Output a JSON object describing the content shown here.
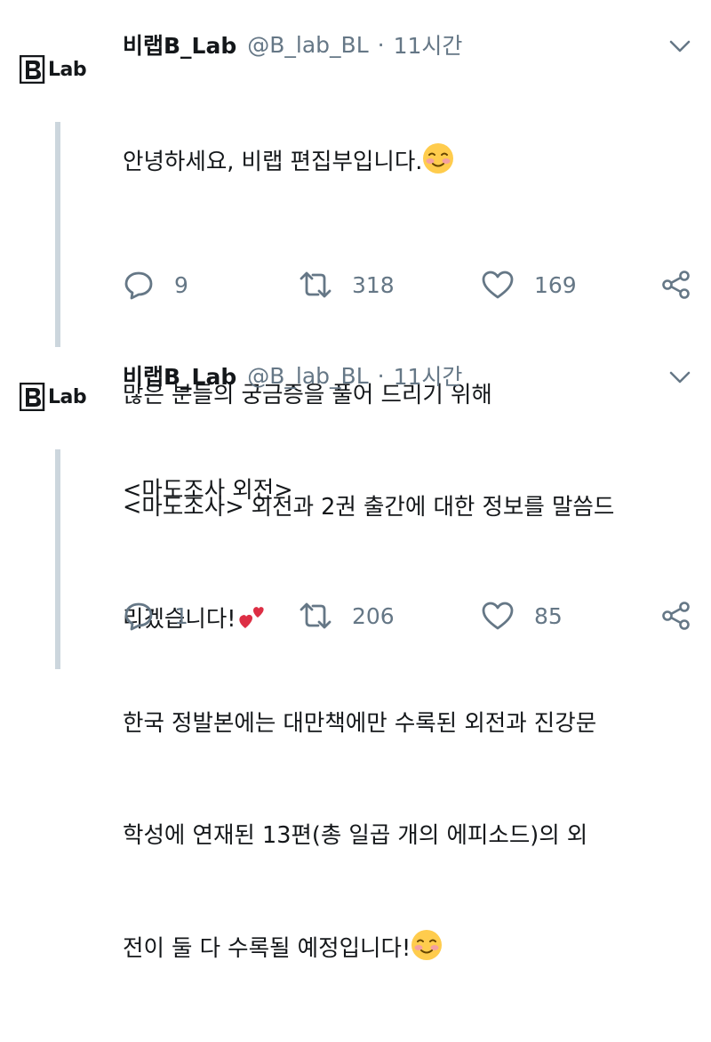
{
  "tweets": [
    {
      "name": "비랩B_Lab",
      "handle": "@B_lab_BL",
      "separator": "·",
      "time": "11시간",
      "avatar_text": "Lab",
      "line1": "안녕하세요, 비랩 편집부입니다.",
      "line1_emoji": "smiling-face-with-blush-emoji",
      "line2": "",
      "line3": "많은 분들의 궁금증을 풀어 드리기 위해",
      "line4": "<마도조사> 외전과 2권 출간에 대한 정보를 말씀드",
      "line5": "리겠습니다!",
      "line5_emoji": "two-hearts-emoji",
      "replies": "9",
      "retweets": "318",
      "likes": "169"
    },
    {
      "name": "비랩B_Lab",
      "handle": "@B_lab_BL",
      "separator": "·",
      "time": "11시간",
      "avatar_text": "Lab",
      "line1": "<마도조사 외전>",
      "line2": "",
      "line3": "한국 정발본에는 대만책에만 수록된 외전과 진강문",
      "line4": "학성에 연재된 13편(총 일곱 개의 에피소드)의 외",
      "line5": "전이 둘 다 수록될 예정입니다!",
      "line5_emoji": "smiling-face-with-blush-emoji",
      "replies": "1",
      "retweets": "206",
      "likes": "85"
    }
  ],
  "colors": {
    "text": "#14171a",
    "secondary": "#657786",
    "thread_line": "#ccd6dd",
    "emoji_face": "#ffcc4d",
    "heart": "#dd2e44"
  }
}
